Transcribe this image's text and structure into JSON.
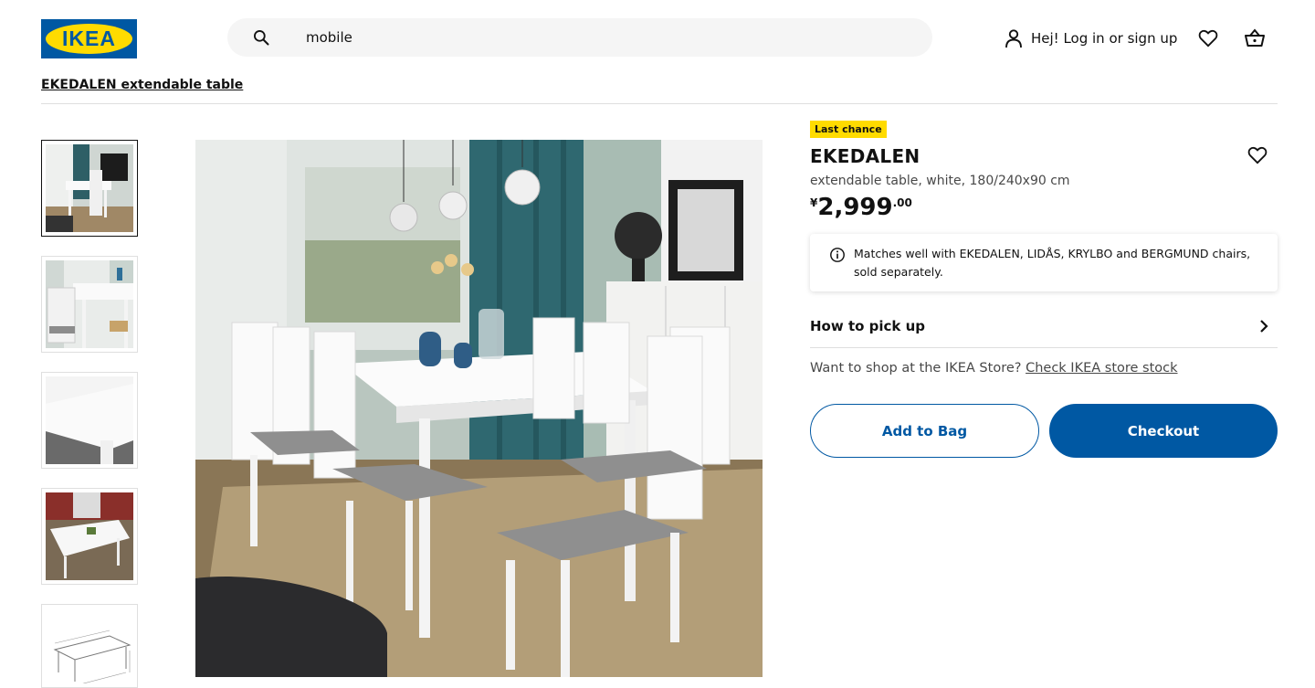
{
  "header": {
    "logo_text": "IKEA",
    "search_value": "mobile",
    "login_label": "Hej! Log in or sign up"
  },
  "breadcrumb": "EKEDALEN extendable table",
  "product": {
    "badge": "Last chance",
    "name": "EKEDALEN",
    "description": "extendable table, white, 180/240x90 cm",
    "price_currency": "¥",
    "price_integer": "2,999",
    "price_decimal": ".00",
    "info_text": "Matches well with EKEDALEN, LIDÅS, KRYLBO and BERGMUND chairs, sold separately.",
    "pickup_label": "How to pick up",
    "store_prompt": "Want to shop at the IKEA Store?",
    "store_link": "Check IKEA store stock",
    "add_to_bag": "Add to Bag",
    "checkout": "Checkout"
  },
  "colors": {
    "brand_blue": "#0058a3",
    "brand_yellow": "#ffdb00"
  },
  "icons": {
    "search": "search-icon",
    "user": "user-icon",
    "favourites": "heart-icon",
    "bag": "shopping-bag-icon",
    "info": "info-icon",
    "chevron": "chevron-right-icon"
  }
}
